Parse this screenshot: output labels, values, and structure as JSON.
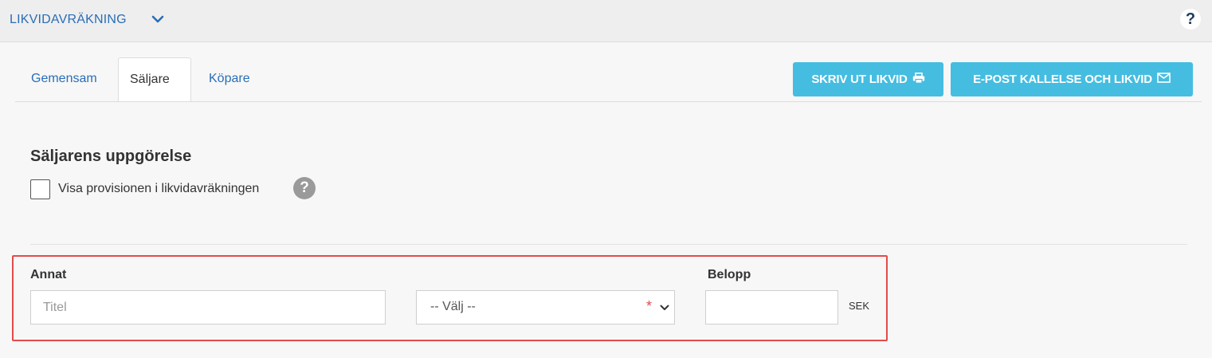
{
  "header": {
    "title": "LIKVIDAVRÄKNING",
    "menu_icon": "chevron-down-icon",
    "help_icon": "question-circle-icon",
    "help_label": "?"
  },
  "tabs": [
    {
      "label": "Gemensam",
      "active": false
    },
    {
      "label": "Säljare",
      "active": true
    },
    {
      "label": "Köpare",
      "active": false
    }
  ],
  "toolbar": {
    "print_label": "SKRIV UT LIKVID",
    "print_icon": "printer-icon",
    "email_label": "E-POST KALLELSE OCH LIKVID",
    "email_icon": "envelope-icon",
    "button_color": "#45bde0"
  },
  "section": {
    "title": "Säljarens uppgörelse",
    "checkbox_label": "Visa provisionen i likvidavräkningen",
    "checkbox_checked": false,
    "help_label": "?"
  },
  "form": {
    "annat_label": "Annat",
    "title_placeholder": "Titel",
    "title_value": "",
    "select_value": "-- Välj --",
    "required_mark": "*",
    "belopp_label": "Belopp",
    "belopp_value": "",
    "currency": "SEK",
    "highlight_color": "#e44a4a"
  }
}
